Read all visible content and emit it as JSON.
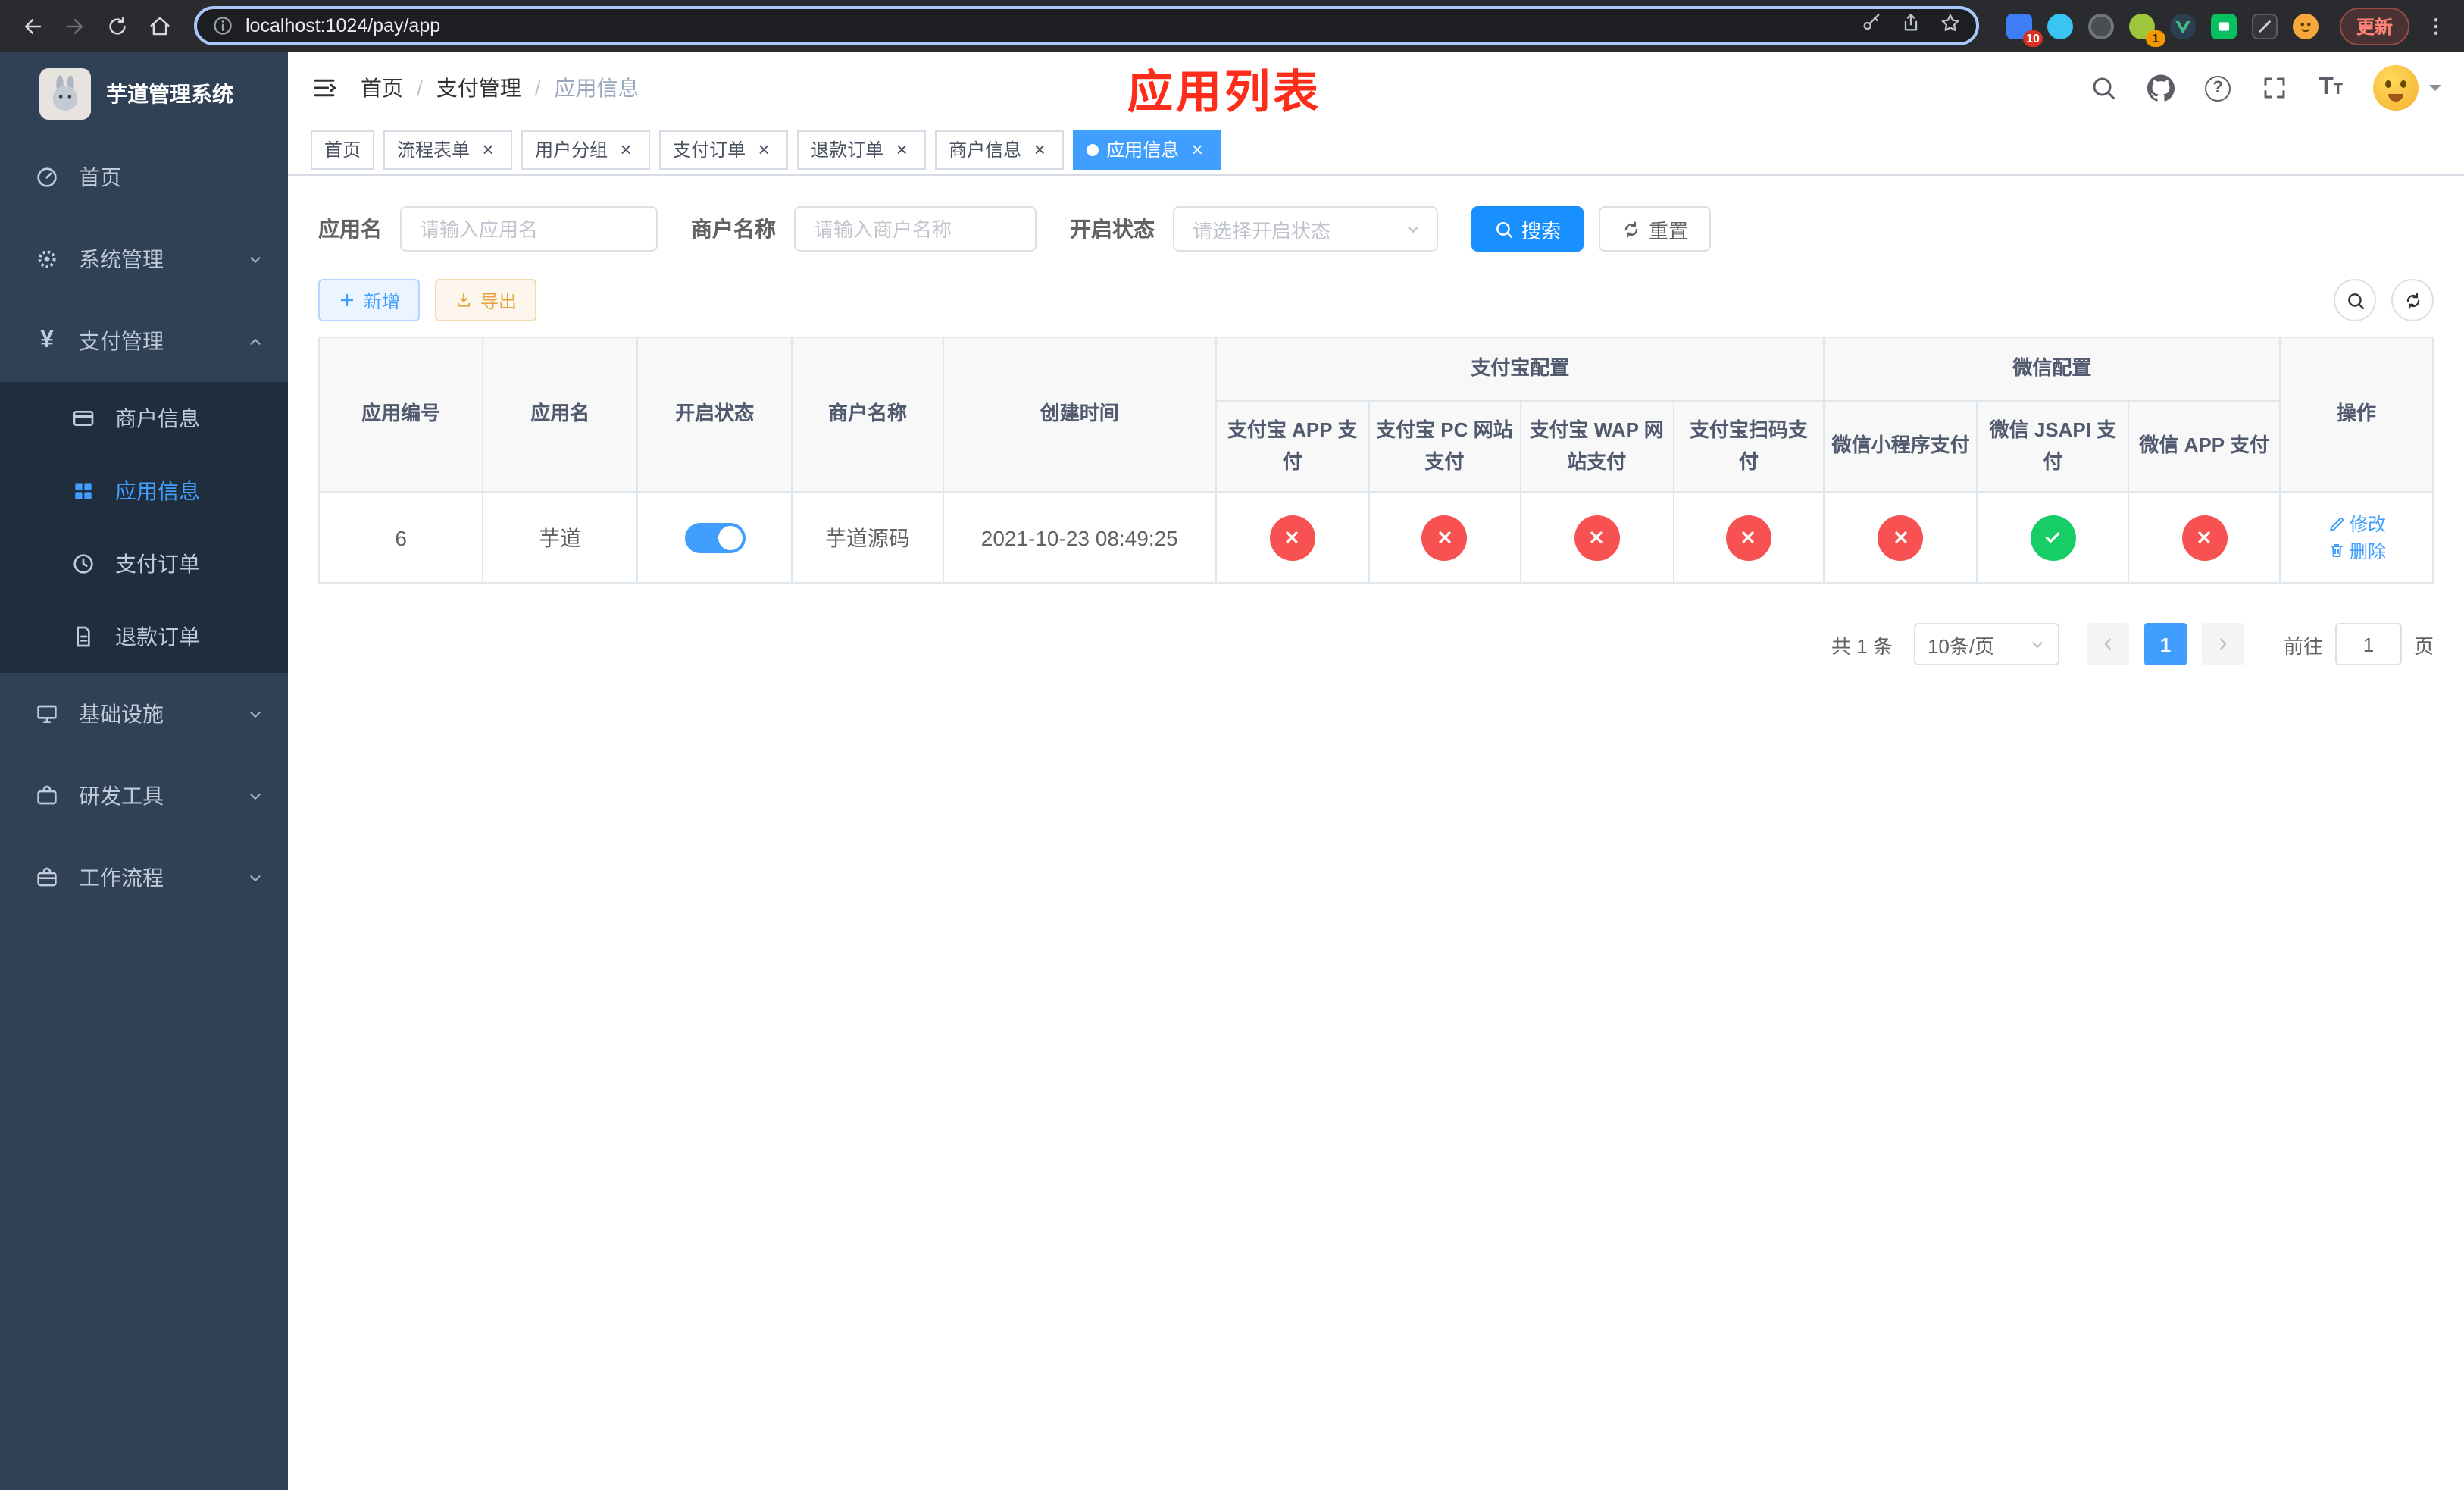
{
  "colors": {
    "accent": "#409eff",
    "search_button": "#1890ff",
    "danger": "#f75151",
    "success": "#17ce66",
    "title_red": "#fe2d1a",
    "sidebar_bg": "#304156",
    "submenu_bg": "#1f2d3d",
    "sidebar_text": "#bfcbd9"
  },
  "browser": {
    "url": "localhost:1024/pay/app",
    "update_label": "更新",
    "ext_badge_blue": "10",
    "ext_badge_green": "1"
  },
  "sidebar": {
    "logo_title": "芋道管理系统",
    "menu": {
      "home": "首页",
      "system": "系统管理",
      "payment": "支付管理",
      "merchant_info": "商户信息",
      "app_info": "应用信息",
      "pay_order": "支付订单",
      "refund_order": "退款订单",
      "infrastructure": "基础设施",
      "dev_tools": "研发工具",
      "workflow": "工作流程"
    }
  },
  "header": {
    "breadcrumb": {
      "home": "首页",
      "payment": "支付管理",
      "current": "应用信息",
      "separator": "/"
    },
    "page_title": "应用列表"
  },
  "tabs": [
    {
      "label": "首页",
      "closable": false,
      "active": false
    },
    {
      "label": "流程表单",
      "closable": true,
      "active": false
    },
    {
      "label": "用户分组",
      "closable": true,
      "active": false
    },
    {
      "label": "支付订单",
      "closable": true,
      "active": false
    },
    {
      "label": "退款订单",
      "closable": true,
      "active": false
    },
    {
      "label": "商户信息",
      "closable": true,
      "active": false
    },
    {
      "label": "应用信息",
      "closable": true,
      "active": true
    }
  ],
  "icons": {
    "close": "×",
    "question": "?",
    "yen": "¥",
    "font_large": "T",
    "font_small": "T"
  },
  "filters": {
    "app_name_label": "应用名",
    "app_name_placeholder": "请输入应用名",
    "merchant_label": "商户名称",
    "merchant_placeholder": "请输入商户名称",
    "status_label": "开启状态",
    "status_placeholder": "请选择开启状态",
    "search_label": "搜索",
    "reset_label": "重置"
  },
  "toolbar": {
    "add_label": "新增",
    "export_label": "导出"
  },
  "table": {
    "columns": {
      "id": "应用编号",
      "name": "应用名",
      "status": "开启状态",
      "merchant": "商户名称",
      "created": "创建时间",
      "alipay_group": "支付宝配置",
      "wechat_group": "微信配置",
      "alipay_app": "支付宝 APP 支付",
      "alipay_pc": "支付宝 PC 网站支付",
      "alipay_wap": "支付宝 WAP 网站支付",
      "alipay_qr": "支付宝扫码支付",
      "wechat_mini": "微信小程序支付",
      "wechat_jsapi": "微信 JSAPI 支付",
      "wechat_app": "微信 APP 支付",
      "ops": "操作"
    },
    "row": {
      "id": "6",
      "name": "芋道",
      "enabled": true,
      "merchant": "芋道源码",
      "created": "2021-10-23 08:49:25",
      "configs": [
        "off",
        "off",
        "off",
        "off",
        "off",
        "on",
        "off"
      ],
      "edit_label": "修改",
      "delete_label": "删除"
    }
  },
  "pagination": {
    "total": "共 1 条",
    "page_size": "10条/页",
    "current_page": "1",
    "goto_label": "前往",
    "goto_value": "1",
    "page_unit": "页"
  }
}
